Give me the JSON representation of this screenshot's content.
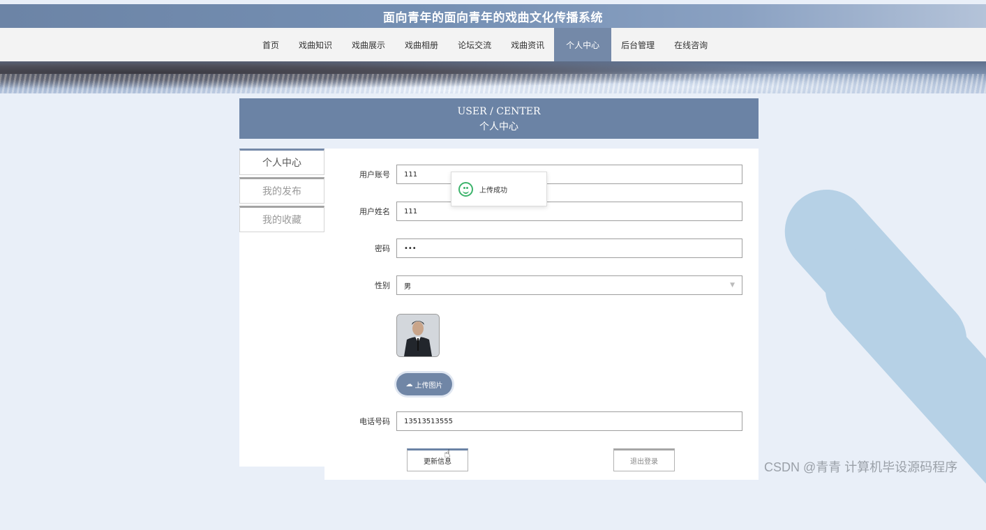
{
  "site_title": "面向青年的面向青年的戏曲文化传播系统",
  "nav": {
    "items": [
      {
        "label": "首页"
      },
      {
        "label": "戏曲知识"
      },
      {
        "label": "戏曲展示"
      },
      {
        "label": "戏曲相册"
      },
      {
        "label": "论坛交流"
      },
      {
        "label": "戏曲资讯"
      },
      {
        "label": "个人中心",
        "active": true
      },
      {
        "label": "后台管理"
      },
      {
        "label": "在线咨询"
      }
    ]
  },
  "section": {
    "title_en": "USER / CENTER",
    "title_cn": "个人中心"
  },
  "sidebar": {
    "items": [
      {
        "label": "个人中心",
        "active": true
      },
      {
        "label": "我的发布"
      },
      {
        "label": "我的收藏"
      }
    ]
  },
  "form": {
    "account_label": "用户账号",
    "account_value": "111",
    "name_label": "用户姓名",
    "name_value": "111",
    "password_label": "密码",
    "password_value": "•••",
    "gender_label": "性别",
    "gender_value": "男",
    "upload_label": "上传图片",
    "phone_label": "电话号码",
    "phone_value": "13513513555",
    "update_label": "更新信息",
    "logout_label": "退出登录"
  },
  "toast": {
    "message": "上传成功"
  },
  "watermark": "CSDN @青青  计算机毕设源码程序",
  "colors": {
    "accent": "#7489a8",
    "background": "#e9eff8",
    "success": "#3cb36b",
    "deco": "#b6d1e6"
  }
}
